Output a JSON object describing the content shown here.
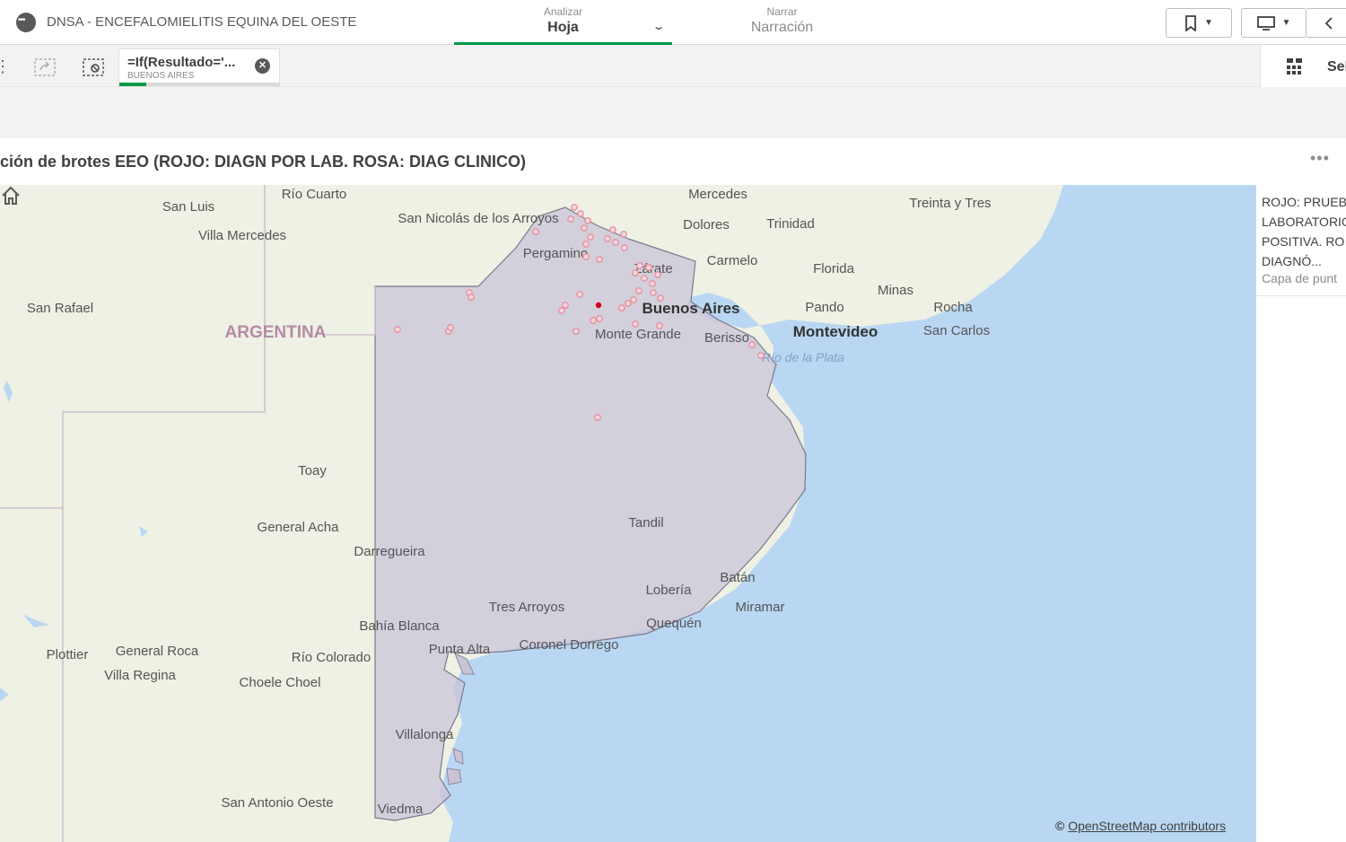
{
  "app": {
    "title": "DNSA - ENCEFALOMIELITIS EQUINA DEL OESTE"
  },
  "tabs": {
    "analizar": {
      "small": "Analizar",
      "big": "Hoja"
    },
    "narrar": {
      "small": "Narrar",
      "big": "Narración"
    }
  },
  "selection": {
    "chip_title": "=If(Resultado='...",
    "chip_sub": "BUENOS AIRES",
    "right_label": "Sel"
  },
  "panel": {
    "title": "ción de brotes EEO (ROJO: DIAGN POR LAB. ROSA: DIAG CLINICO)",
    "menu": "•••"
  },
  "legend": {
    "text": "ROJO: PRUEB LABORATORIO POSITIVA. RO DIAGNÓ...",
    "caption": "Capa de punt"
  },
  "map": {
    "country": "ARGENTINA",
    "water": "Río de la Plata",
    "attribution_symbol": "©",
    "attribution": "OpenStreetMap contributors",
    "places": [
      "Río Cuarto",
      "San Luis",
      "Villa Mercedes",
      "San Rafael",
      "San Nicolás de los Arroyos",
      "Pergamino",
      "Mercedes",
      "Dolores",
      "Trinidad",
      "Treinta y Tres",
      "Zárate",
      "Carmelo",
      "Florida",
      "Minas",
      "Buenos Aires",
      "Pando",
      "Rocha",
      "Montevideo",
      "San Carlos",
      "Monte Grande",
      "Berisso",
      "Toay",
      "General Acha",
      "Darregueira",
      "Tandil",
      "Batán",
      "Lobería",
      "Miramar",
      "Tres Arroyos",
      "Bahía Blanca",
      "Quequén",
      "Punta Alta",
      "Coronel Dorrego",
      "Plottier",
      "General Roca",
      "Río Colorado",
      "Villa Regina",
      "Choele Choel",
      "Villalonga",
      "San Antonio Oeste",
      "Viedma"
    ],
    "colors": {
      "land": "#eef1e3",
      "water": "#b9d7f2",
      "region_fill": "#c9c3d8",
      "outbreak_clinical": "#e58f9f",
      "outbreak_lab": "#d0021b"
    }
  }
}
